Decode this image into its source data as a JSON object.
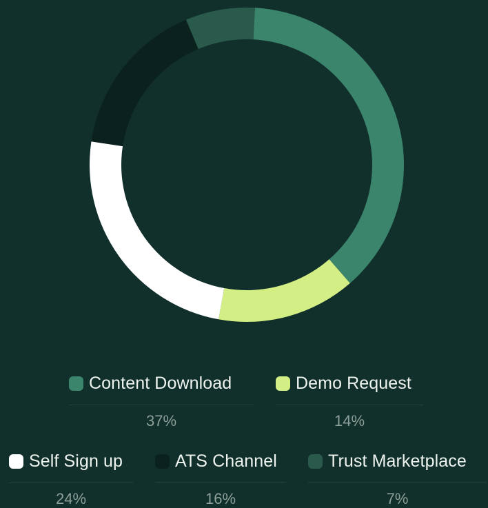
{
  "chart_data": {
    "type": "pie",
    "start_angle_deg": 3,
    "categories": [
      "Content Download",
      "Demo Request",
      "Self Sign up",
      "ATS Channel",
      "Trust Marketplace"
    ],
    "values": [
      37,
      14,
      24,
      16,
      7
    ],
    "labels": [
      "37%",
      "14%",
      "24%",
      "16%",
      "7%"
    ],
    "colors": [
      "#3a856b",
      "#d3ee84",
      "#ffffff",
      "#0b211d",
      "#2a5a4b"
    ]
  },
  "colors": {
    "background": "#11302b",
    "text": "#eef3ef",
    "value_text": "#8d9f98",
    "divider": "#24423c"
  }
}
